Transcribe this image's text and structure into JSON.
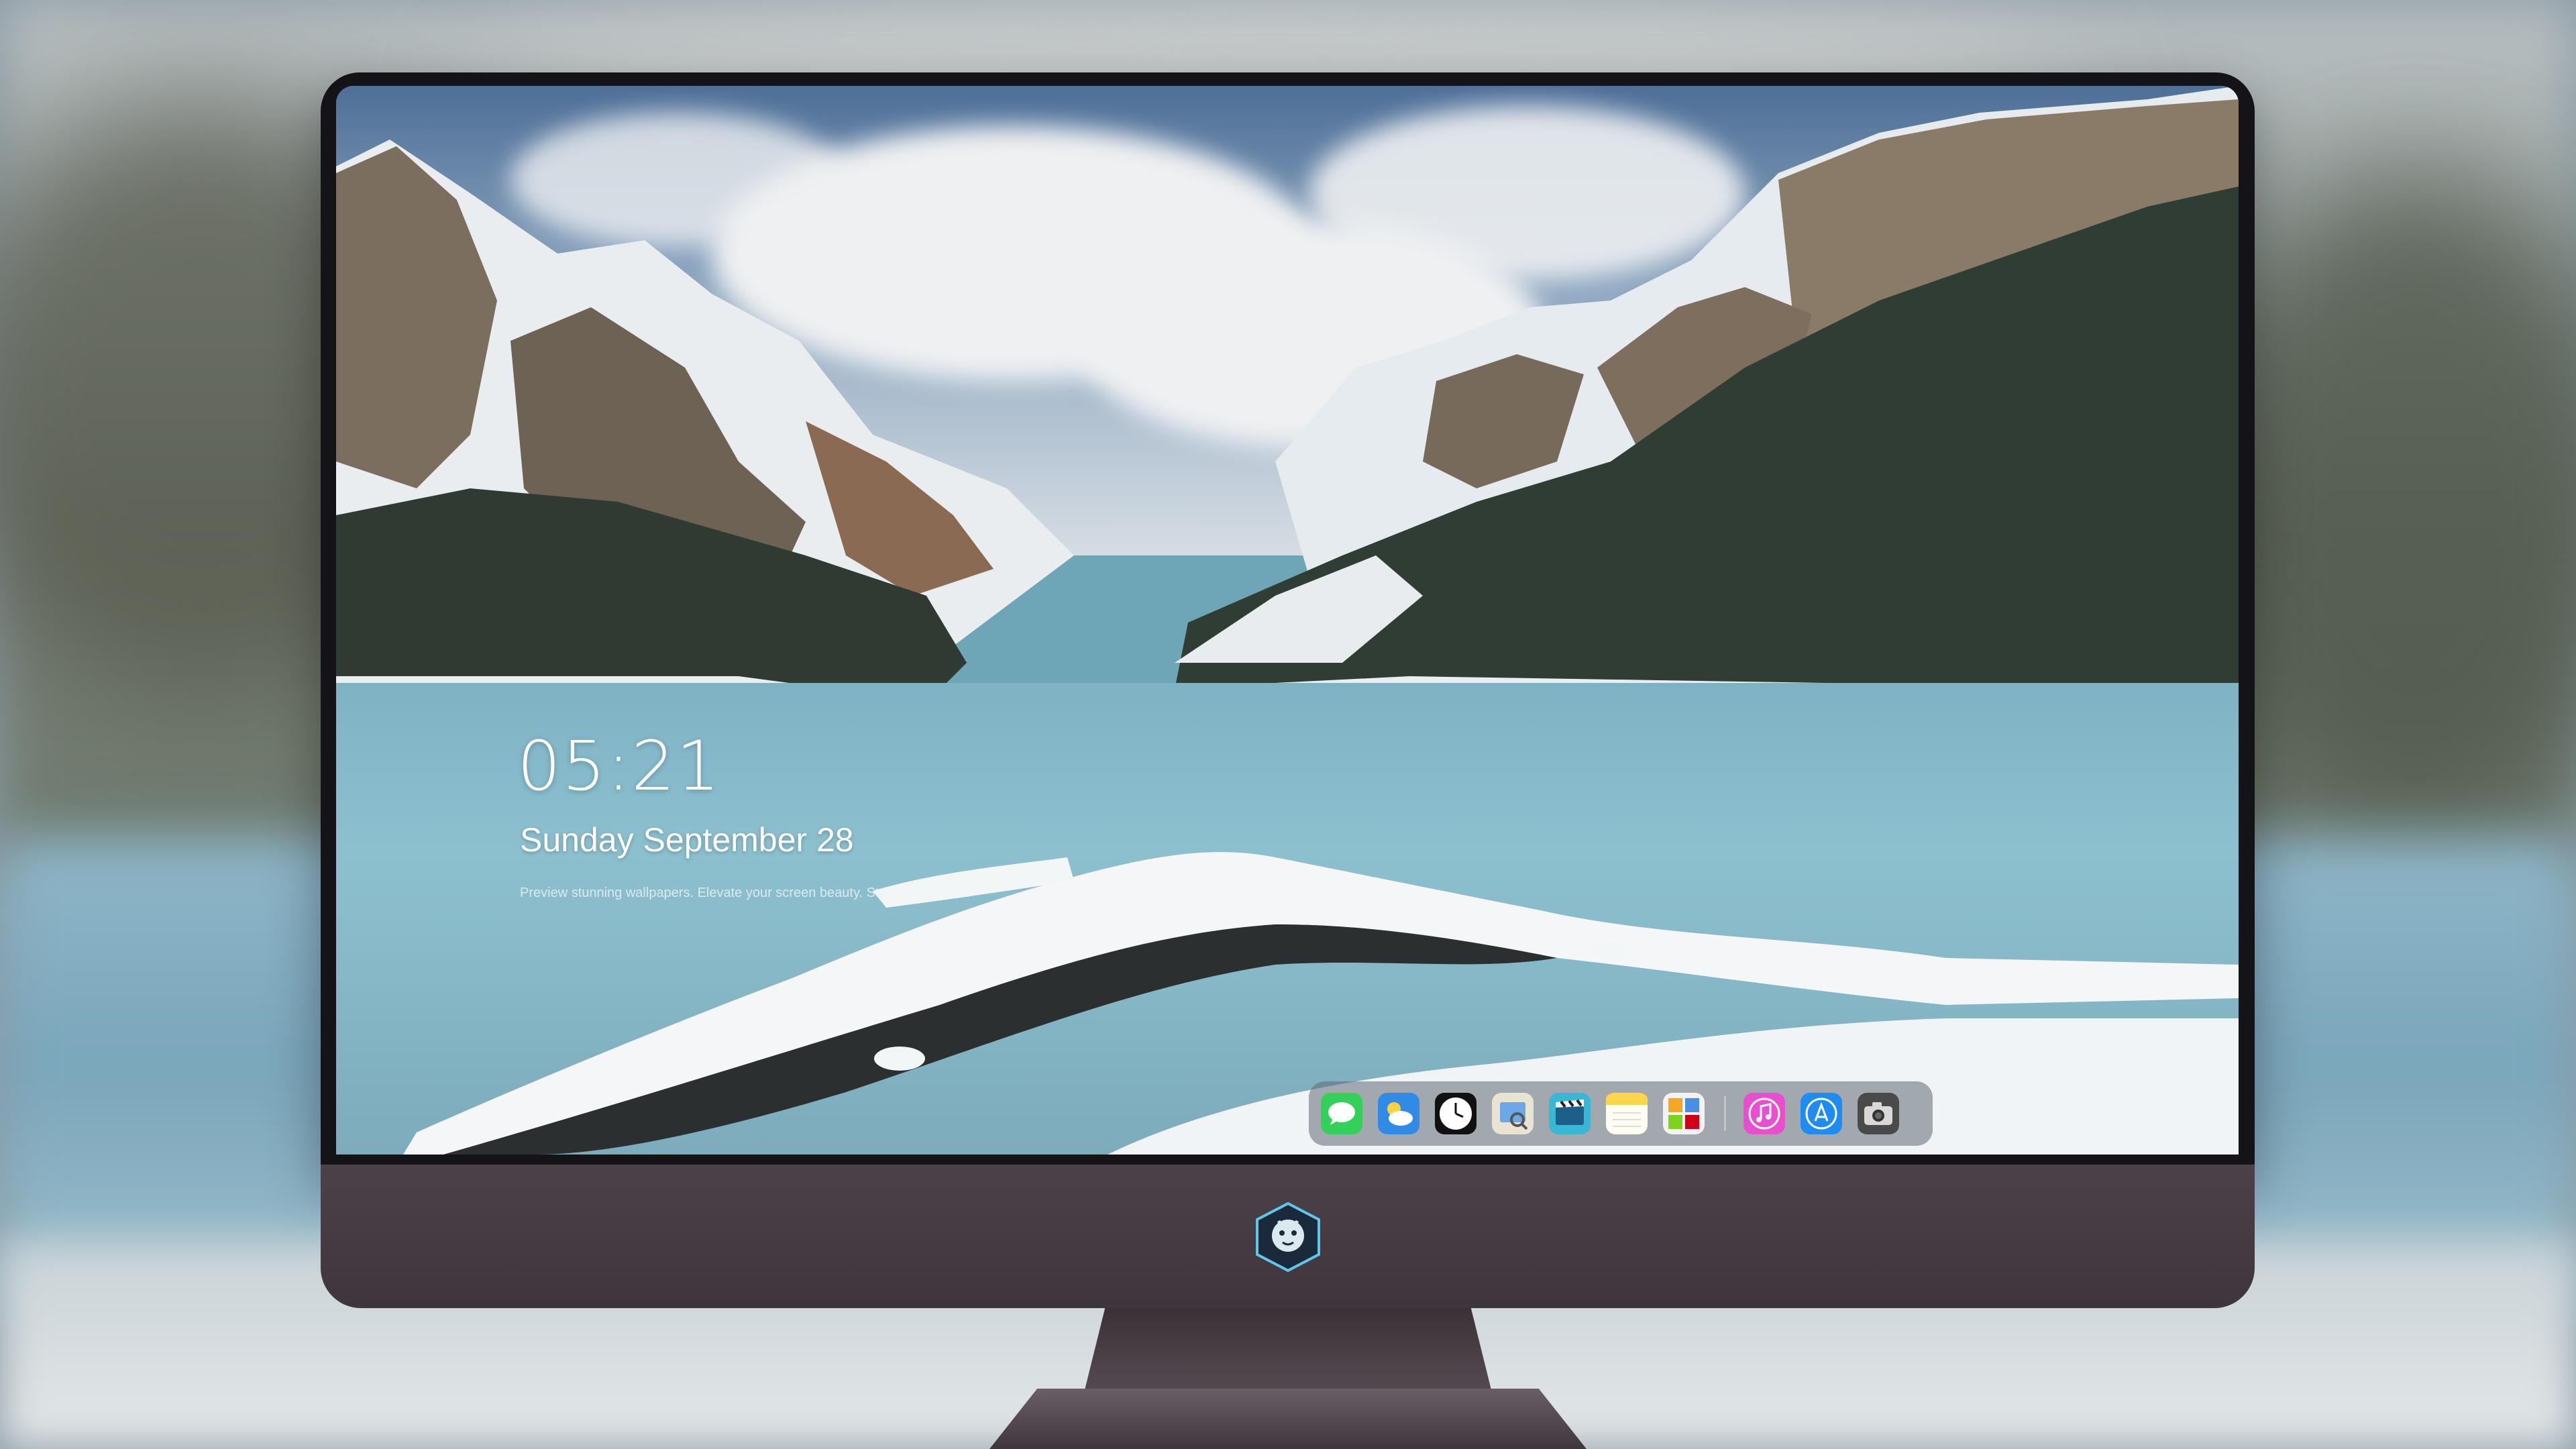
{
  "lockscreen": {
    "time": "05:21",
    "date": "Sunday September  28",
    "tagline": "Preview stunning wallpapers. Elevate your screen beauty. Start... Bing 2024"
  },
  "dock": {
    "apps": [
      {
        "name": "messages-icon"
      },
      {
        "name": "weather-icon"
      },
      {
        "name": "clock-icon"
      },
      {
        "name": "preview-icon"
      },
      {
        "name": "clips-icon"
      },
      {
        "name": "notes-icon"
      },
      {
        "name": "photo-booth-icon"
      },
      {
        "name": "music-icon"
      },
      {
        "name": "app-store-icon"
      },
      {
        "name": "camera-icon"
      }
    ]
  },
  "colors": {
    "accent_lake": "#8dc0cf",
    "bezel": "#141418",
    "chin": "#433a42"
  }
}
